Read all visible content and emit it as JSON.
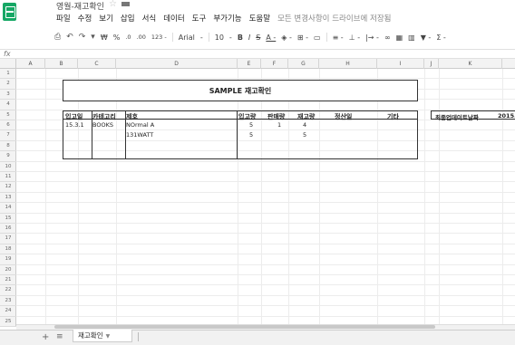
{
  "app": {
    "title": "영월-재고확인",
    "save_status": "모든 변경사항이 드라이브에 저장됨"
  },
  "menu": [
    "파일",
    "수정",
    "보기",
    "삽입",
    "서식",
    "데이터",
    "도구",
    "부가기능",
    "도움말"
  ],
  "toolbar": {
    "items": [
      "⎙",
      "↶",
      "↷",
      "▾",
      "₩",
      "%",
      ".0",
      ".00",
      "123 -",
      "Arial",
      "-",
      "10",
      "-",
      "B",
      "I",
      "S",
      "A -",
      "◈ -",
      "⊞ -",
      "▭",
      "≡ -",
      "⊥ -",
      "|→ -",
      "∞",
      "▦",
      "▥",
      "▼ -",
      "Σ -"
    ]
  },
  "formula_bar": {
    "label": "fx"
  },
  "columns": [
    "A",
    "B",
    "C",
    "D",
    "E",
    "F",
    "G",
    "H",
    "I",
    "J",
    "K"
  ],
  "rows": [
    "1",
    "2",
    "3",
    "4",
    "5",
    "6",
    "7",
    "8",
    "9",
    "10",
    "11",
    "12",
    "13",
    "14",
    "15",
    "16",
    "17",
    "18",
    "19",
    "20",
    "21",
    "22",
    "23",
    "24",
    "25"
  ],
  "sheet_title": "SAMPLE 재고확인",
  "table": {
    "headers": [
      "입고일",
      "카테고리",
      "제호",
      "입고량",
      "판매량",
      "재고량",
      "정산일",
      "기타"
    ],
    "rows": [
      {
        "date": "15.3.1",
        "category": "BOOKS",
        "name": "NOrmal A",
        "in": "5",
        "sold": "1",
        "stock": "4"
      },
      {
        "date": "",
        "category": "",
        "name": "131WATT",
        "in": "5",
        "sold": "",
        "stock": "5"
      }
    ]
  },
  "side": {
    "label": "최종업데이트날짜",
    "value": "2015."
  },
  "sheet_tab": {
    "name": "재고확인",
    "add": "+",
    "list": "≡"
  }
}
